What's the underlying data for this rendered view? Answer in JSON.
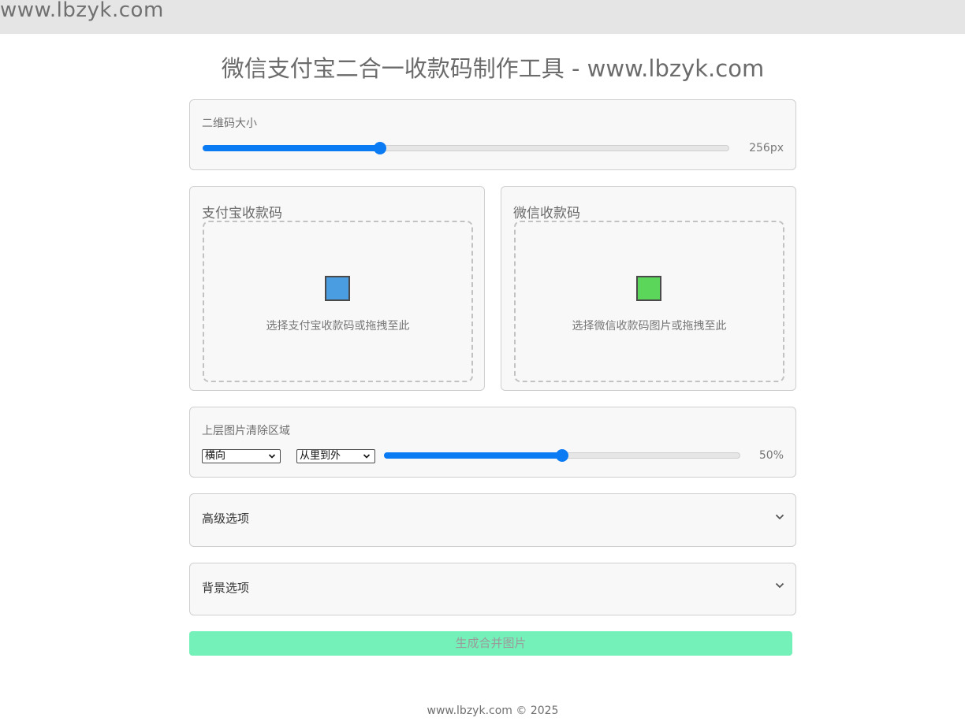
{
  "header": {
    "site": "www.lbzyk.com"
  },
  "title": "微信支付宝二合一收款码制作工具 - www.lbzyk.com",
  "qr_size": {
    "label": "二维码大小",
    "value_text": "256px",
    "fraction": 0.337
  },
  "alipay": {
    "title": "支付宝收款码",
    "drop_text": "选择支付宝收款码或拖拽至此",
    "icon": "alipay-qr-placeholder-icon",
    "color": "#4a9de0"
  },
  "wechat": {
    "title": "微信收款码",
    "drop_text": "选择微信收款码图片或拖拽至此",
    "icon": "wechat-qr-placeholder-icon",
    "color": "#5bd65b"
  },
  "clear_area": {
    "label": "上层图片清除区域",
    "direction": "横向",
    "order": "从里到外",
    "value_text": "50%",
    "fraction": 0.5
  },
  "advanced": {
    "label": "高级选项"
  },
  "background": {
    "label": "背景选项"
  },
  "generate": {
    "label": "生成合并图片"
  },
  "footer": {
    "text": "www.lbzyk.com © 2025"
  },
  "colors": {
    "accent": "#0b7bf4",
    "generate_button": "#74f0b9"
  }
}
